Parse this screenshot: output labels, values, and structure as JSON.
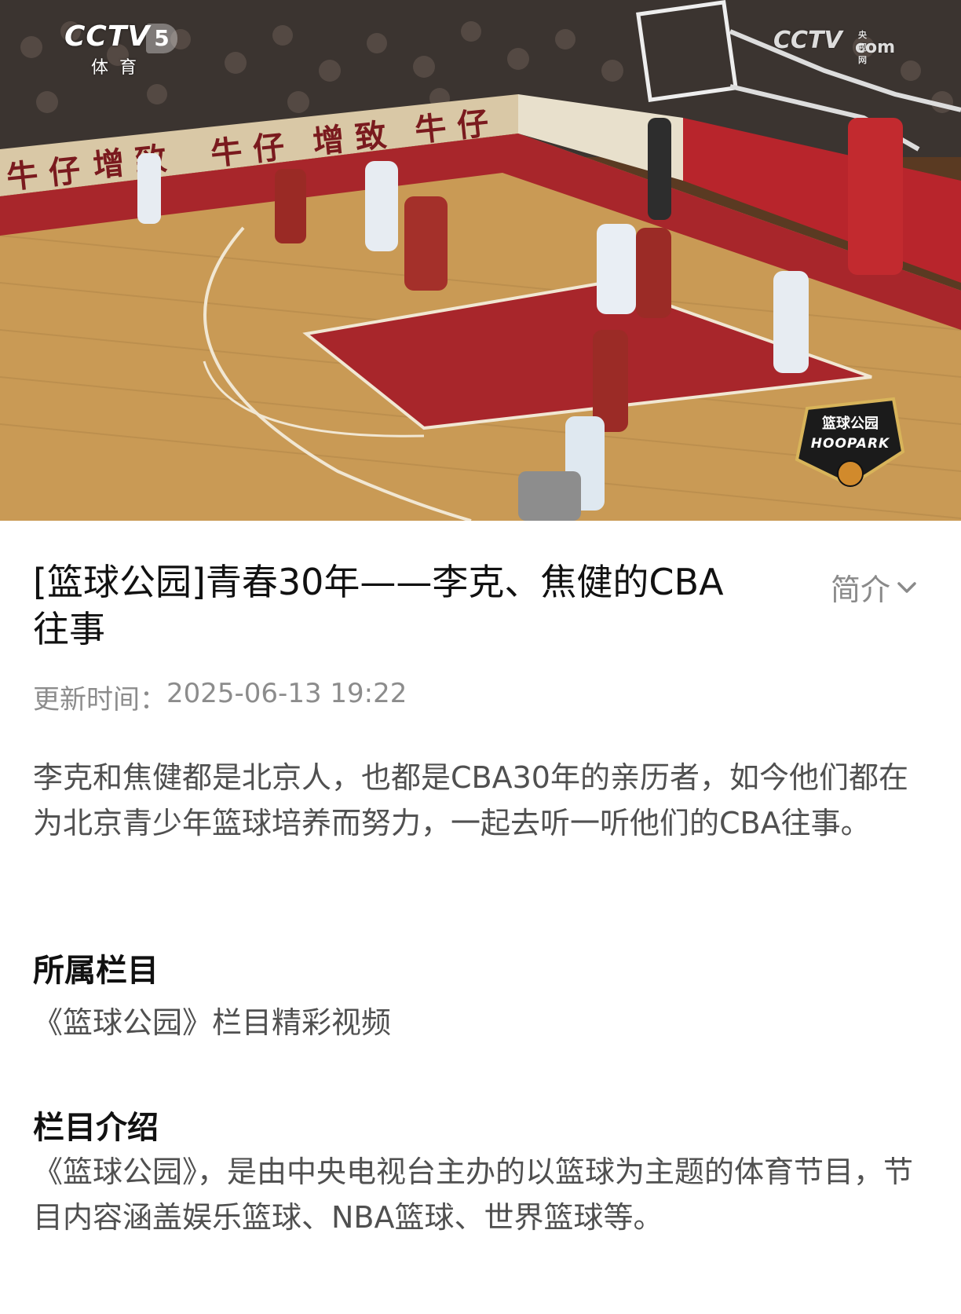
{
  "video": {
    "channel_logo": "CCTV",
    "channel_number": "5",
    "channel_sub": "体育",
    "watermark_main": "CCTV",
    "watermark_small": "央视网",
    "watermark_com": "com",
    "badge_line1": "篮球公园",
    "badge_line2": "HOOPARK",
    "court_banner_text": "牛仔 增致 牛仔 增致 牛仔"
  },
  "article": {
    "title": "[篮球公园]青春30年——李克、焦健的CBA往事",
    "intro_toggle_label": "简介",
    "update_label": "更新时间：",
    "update_time": "2025-06-13 19:22",
    "description": "李克和焦健都是北京人，也都是CBA30年的亲历者，如今他们都在为北京青少年篮球培养而努力，一起去听一听他们的CBA往事。"
  },
  "sections": {
    "column_heading": "所属栏目",
    "column_value": "《篮球公园》栏目精彩视频",
    "intro_heading": "栏目介绍",
    "intro_value": "《篮球公园》，是由中央电视台主办的以篮球为主题的体育节目，节目内容涵盖娱乐篮球、NBA篮球、世界篮球等。"
  },
  "icons": {
    "toggle": "chevron-down-icon",
    "play_area": "video-frame"
  },
  "colors": {
    "title": "#111111",
    "meta": "#8c8c8c",
    "body": "#505050",
    "court_red": "#a8262b",
    "floor": "#c99a55"
  }
}
